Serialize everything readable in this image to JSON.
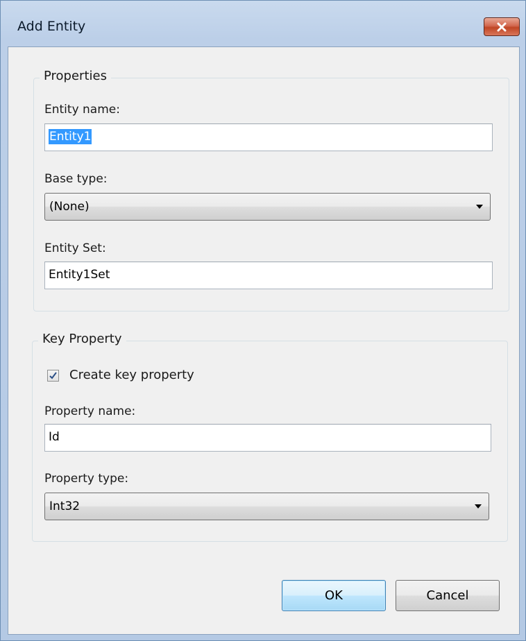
{
  "window": {
    "title": "Add Entity",
    "close_icon": "close-x-icon"
  },
  "properties": {
    "legend": "Properties",
    "entity_name_label": "Entity name:",
    "entity_name_value": "Entity1",
    "base_type_label": "Base type:",
    "base_type_value": "(None)",
    "entity_set_label": "Entity Set:",
    "entity_set_value": "Entity1Set"
  },
  "key_property": {
    "legend": "Key Property",
    "create_key_label": "Create key property",
    "create_key_checked": true,
    "property_name_label": "Property name:",
    "property_name_value": "Id",
    "property_type_label": "Property type:",
    "property_type_value": "Int32"
  },
  "buttons": {
    "ok_label": "OK",
    "cancel_label": "Cancel"
  },
  "colors": {
    "selection": "#3399ff",
    "default_button": "#bee6fd",
    "close_button": "#c04625"
  }
}
